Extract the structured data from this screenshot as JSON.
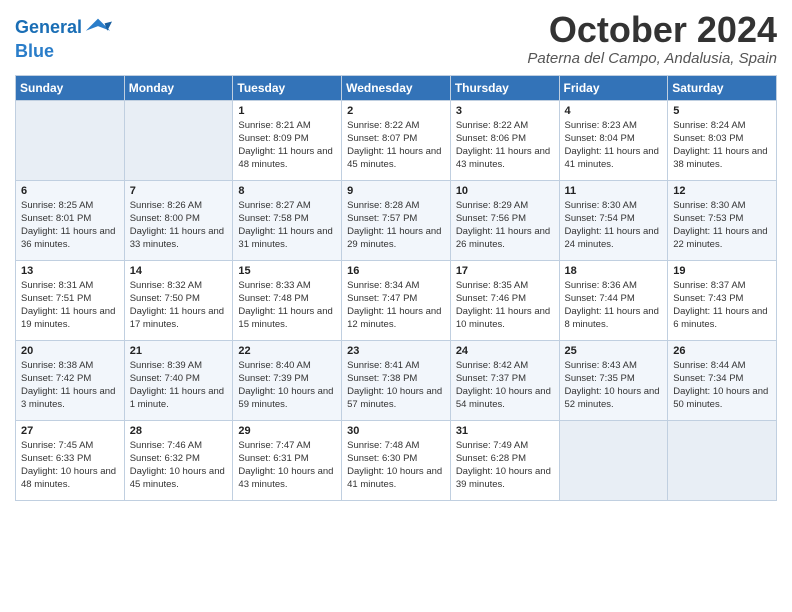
{
  "logo": {
    "line1": "General",
    "line2": "Blue"
  },
  "title": "October 2024",
  "subtitle": "Paterna del Campo, Andalusia, Spain",
  "days_of_week": [
    "Sunday",
    "Monday",
    "Tuesday",
    "Wednesday",
    "Thursday",
    "Friday",
    "Saturday"
  ],
  "weeks": [
    [
      {
        "day": "",
        "info": ""
      },
      {
        "day": "",
        "info": ""
      },
      {
        "day": "1",
        "info": "Sunrise: 8:21 AM\nSunset: 8:09 PM\nDaylight: 11 hours and 48 minutes."
      },
      {
        "day": "2",
        "info": "Sunrise: 8:22 AM\nSunset: 8:07 PM\nDaylight: 11 hours and 45 minutes."
      },
      {
        "day": "3",
        "info": "Sunrise: 8:22 AM\nSunset: 8:06 PM\nDaylight: 11 hours and 43 minutes."
      },
      {
        "day": "4",
        "info": "Sunrise: 8:23 AM\nSunset: 8:04 PM\nDaylight: 11 hours and 41 minutes."
      },
      {
        "day": "5",
        "info": "Sunrise: 8:24 AM\nSunset: 8:03 PM\nDaylight: 11 hours and 38 minutes."
      }
    ],
    [
      {
        "day": "6",
        "info": "Sunrise: 8:25 AM\nSunset: 8:01 PM\nDaylight: 11 hours and 36 minutes."
      },
      {
        "day": "7",
        "info": "Sunrise: 8:26 AM\nSunset: 8:00 PM\nDaylight: 11 hours and 33 minutes."
      },
      {
        "day": "8",
        "info": "Sunrise: 8:27 AM\nSunset: 7:58 PM\nDaylight: 11 hours and 31 minutes."
      },
      {
        "day": "9",
        "info": "Sunrise: 8:28 AM\nSunset: 7:57 PM\nDaylight: 11 hours and 29 minutes."
      },
      {
        "day": "10",
        "info": "Sunrise: 8:29 AM\nSunset: 7:56 PM\nDaylight: 11 hours and 26 minutes."
      },
      {
        "day": "11",
        "info": "Sunrise: 8:30 AM\nSunset: 7:54 PM\nDaylight: 11 hours and 24 minutes."
      },
      {
        "day": "12",
        "info": "Sunrise: 8:30 AM\nSunset: 7:53 PM\nDaylight: 11 hours and 22 minutes."
      }
    ],
    [
      {
        "day": "13",
        "info": "Sunrise: 8:31 AM\nSunset: 7:51 PM\nDaylight: 11 hours and 19 minutes."
      },
      {
        "day": "14",
        "info": "Sunrise: 8:32 AM\nSunset: 7:50 PM\nDaylight: 11 hours and 17 minutes."
      },
      {
        "day": "15",
        "info": "Sunrise: 8:33 AM\nSunset: 7:48 PM\nDaylight: 11 hours and 15 minutes."
      },
      {
        "day": "16",
        "info": "Sunrise: 8:34 AM\nSunset: 7:47 PM\nDaylight: 11 hours and 12 minutes."
      },
      {
        "day": "17",
        "info": "Sunrise: 8:35 AM\nSunset: 7:46 PM\nDaylight: 11 hours and 10 minutes."
      },
      {
        "day": "18",
        "info": "Sunrise: 8:36 AM\nSunset: 7:44 PM\nDaylight: 11 hours and 8 minutes."
      },
      {
        "day": "19",
        "info": "Sunrise: 8:37 AM\nSunset: 7:43 PM\nDaylight: 11 hours and 6 minutes."
      }
    ],
    [
      {
        "day": "20",
        "info": "Sunrise: 8:38 AM\nSunset: 7:42 PM\nDaylight: 11 hours and 3 minutes."
      },
      {
        "day": "21",
        "info": "Sunrise: 8:39 AM\nSunset: 7:40 PM\nDaylight: 11 hours and 1 minute."
      },
      {
        "day": "22",
        "info": "Sunrise: 8:40 AM\nSunset: 7:39 PM\nDaylight: 10 hours and 59 minutes."
      },
      {
        "day": "23",
        "info": "Sunrise: 8:41 AM\nSunset: 7:38 PM\nDaylight: 10 hours and 57 minutes."
      },
      {
        "day": "24",
        "info": "Sunrise: 8:42 AM\nSunset: 7:37 PM\nDaylight: 10 hours and 54 minutes."
      },
      {
        "day": "25",
        "info": "Sunrise: 8:43 AM\nSunset: 7:35 PM\nDaylight: 10 hours and 52 minutes."
      },
      {
        "day": "26",
        "info": "Sunrise: 8:44 AM\nSunset: 7:34 PM\nDaylight: 10 hours and 50 minutes."
      }
    ],
    [
      {
        "day": "27",
        "info": "Sunrise: 7:45 AM\nSunset: 6:33 PM\nDaylight: 10 hours and 48 minutes."
      },
      {
        "day": "28",
        "info": "Sunrise: 7:46 AM\nSunset: 6:32 PM\nDaylight: 10 hours and 45 minutes."
      },
      {
        "day": "29",
        "info": "Sunrise: 7:47 AM\nSunset: 6:31 PM\nDaylight: 10 hours and 43 minutes."
      },
      {
        "day": "30",
        "info": "Sunrise: 7:48 AM\nSunset: 6:30 PM\nDaylight: 10 hours and 41 minutes."
      },
      {
        "day": "31",
        "info": "Sunrise: 7:49 AM\nSunset: 6:28 PM\nDaylight: 10 hours and 39 minutes."
      },
      {
        "day": "",
        "info": ""
      },
      {
        "day": "",
        "info": ""
      }
    ]
  ]
}
